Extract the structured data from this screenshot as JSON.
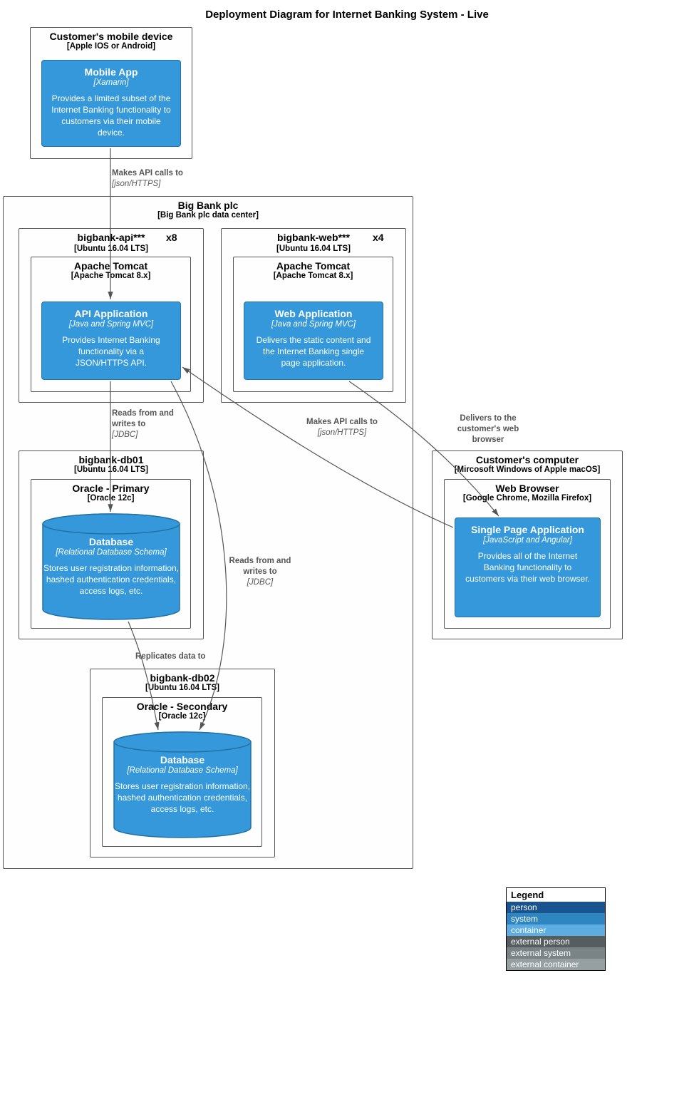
{
  "title": "Deployment Diagram for Internet Banking System - Live",
  "nodes": {
    "mobileDevice": {
      "title": "Customer's mobile device",
      "sub": "[Apple IOS or Android]"
    },
    "mobileApp": {
      "title": "Mobile App",
      "tech": "[Xamarin]",
      "desc": "Provides a limited subset of the Internet Banking functionality to customers via their mobile device."
    },
    "bigBank": {
      "title": "Big Bank plc",
      "sub": "[Big Bank plc data center]"
    },
    "apiNode": {
      "title": "bigbank-api***",
      "instances": "x8",
      "sub": "[Ubuntu 16.04 LTS]"
    },
    "tomcat1": {
      "title": "Apache Tomcat",
      "sub": "[Apache Tomcat 8.x]"
    },
    "apiApp": {
      "title": "API Application",
      "tech": "[Java and Spring MVC]",
      "desc": "Provides Internet Banking functionality via a JSON/HTTPS API."
    },
    "webNode": {
      "title": "bigbank-web***",
      "instances": "x4",
      "sub": "[Ubuntu 16.04 LTS]"
    },
    "tomcat2": {
      "title": "Apache Tomcat",
      "sub": "[Apache Tomcat 8.x]"
    },
    "webApp": {
      "title": "Web Application",
      "tech": "[Java and Spring MVC]",
      "desc": "Delivers the static content and the Internet Banking single page application."
    },
    "db01": {
      "title": "bigbank-db01",
      "sub": "[Ubuntu 16.04 LTS]"
    },
    "oracle1": {
      "title": "Oracle - Primary",
      "sub": "[Oracle 12c]"
    },
    "database1": {
      "title": "Database",
      "tech": "[Relational Database Schema]",
      "desc": "Stores user registration information, hashed authentication credentials, access logs, etc."
    },
    "db02": {
      "title": "bigbank-db02",
      "sub": "[Ubuntu 16.04 LTS]"
    },
    "oracle2": {
      "title": "Oracle - Secondary",
      "sub": "[Oracle 12c]"
    },
    "database2": {
      "title": "Database",
      "tech": "[Relational Database Schema]",
      "desc": "Stores user registration information, hashed authentication credentials, access logs, etc."
    },
    "computer": {
      "title": "Customer's computer",
      "sub": "[Mircosoft Windows of Apple macOS]"
    },
    "browser": {
      "title": "Web Browser",
      "sub": "[Google Chrome, Mozilla Firefox]"
    },
    "spa": {
      "title": "Single Page Application",
      "tech": "[JavaScript and Angular]",
      "desc": "Provides all of the Internet Banking functionality to customers via their web browser."
    }
  },
  "edges": {
    "e1": {
      "label": "Makes API calls to",
      "tech": "[json/HTTPS]"
    },
    "e2": {
      "label": "Reads from and writes to",
      "tech": "[JDBC]"
    },
    "e3": {
      "label": "Makes API calls to",
      "tech": "[json/HTTPS]"
    },
    "e4": {
      "label": "Delivers to the customer's web browser",
      "tech": ""
    },
    "e5": {
      "label": "Replicates data to",
      "tech": ""
    },
    "e6": {
      "label": "Reads from and writes to",
      "tech": "[JDBC]"
    }
  },
  "legend": {
    "title": "Legend",
    "rows": [
      {
        "label": "person",
        "color": "#1a5490"
      },
      {
        "label": "system",
        "color": "#2e86c1"
      },
      {
        "label": "container",
        "color": "#5dade2"
      },
      {
        "label": "external person",
        "color": "#555d5f"
      },
      {
        "label": "external system",
        "color": "#7a8487"
      },
      {
        "label": "external container",
        "color": "#96a0a3"
      }
    ]
  }
}
